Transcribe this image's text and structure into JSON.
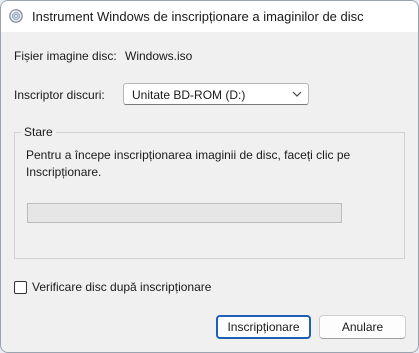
{
  "window": {
    "title": "Instrument Windows de inscripționare a imaginilor de disc",
    "icon": "disc-burner-icon"
  },
  "image_file": {
    "label": "Fișier imagine disc:",
    "value": "Windows.iso"
  },
  "burner": {
    "label": "Inscriptor discuri:",
    "selected": "Unitate BD-ROM (D:)"
  },
  "status": {
    "legend": "Stare",
    "message": "Pentru a începe inscripționarea imaginii de disc, faceți clic pe Inscripționare.",
    "progress_percent": 0
  },
  "verify": {
    "label": "Verificare disc după inscripționare",
    "checked": false
  },
  "buttons": {
    "burn": "Inscripționare",
    "cancel": "Anulare"
  },
  "colors": {
    "accent": "#1f5fb8",
    "progress_track": "#e6e6e6"
  }
}
